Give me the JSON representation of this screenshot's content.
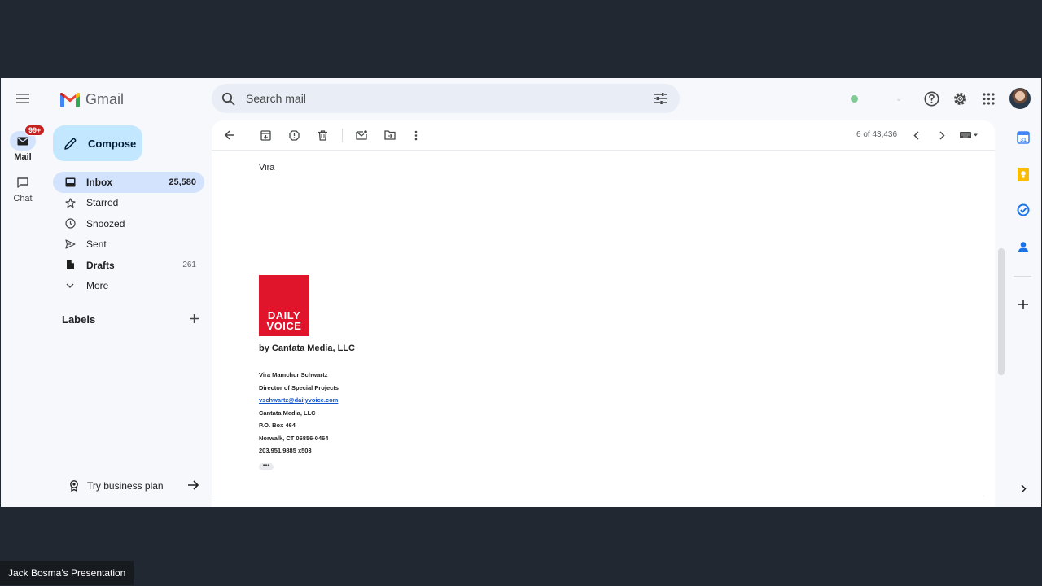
{
  "app": {
    "name": "Gmail"
  },
  "rail": {
    "mail_label": "Mail",
    "mail_badge": "99+",
    "chat_label": "Chat"
  },
  "search": {
    "placeholder": "Search mail"
  },
  "compose_label": "Compose",
  "nav": [
    {
      "label": "Inbox",
      "count": "25,580",
      "icon": "inbox-icon"
    },
    {
      "label": "Starred",
      "count": "",
      "icon": "star-icon"
    },
    {
      "label": "Snoozed",
      "count": "",
      "icon": "clock-icon"
    },
    {
      "label": "Sent",
      "count": "",
      "icon": "send-icon"
    },
    {
      "label": "Drafts",
      "count": "261",
      "icon": "draft-icon"
    },
    {
      "label": "More",
      "count": "",
      "icon": "chevron-down-icon"
    }
  ],
  "labels_header": "Labels",
  "try_business": "Try business plan",
  "toolbar": {
    "pager": "6 of 43,436"
  },
  "message": {
    "greeting": "Vira",
    "logo_line1": "DAILY",
    "logo_line2": "VOICE",
    "company_tagline": "by Cantata Media, LLC",
    "signature": {
      "name": "Vira Mamchur Schwartz",
      "title": "Director of Special Projects",
      "email": "vschwartz@dailyvoice.com",
      "company": "Cantata Media, LLC",
      "po_box": "P.O. Box 464",
      "city": "Norwalk, CT 06856-0464",
      "phone": "203.951.9885 x503"
    },
    "show_trimmed": "•••"
  },
  "colors": {
    "accent": "#c2e7ff",
    "active_nav": "#d3e3fd",
    "brand_red": "#e0142b",
    "badge": "#c5221f"
  },
  "footer": {
    "presentation_label": "Jack Bosma's Presentation"
  }
}
